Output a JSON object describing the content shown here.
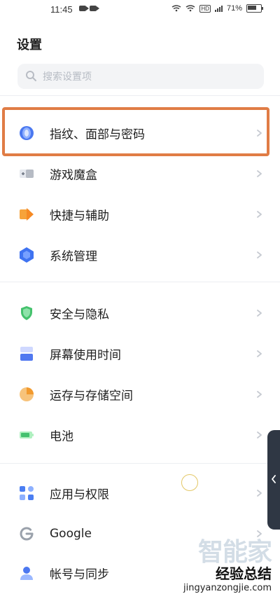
{
  "status_bar": {
    "time": "11:45",
    "battery_text": "71%"
  },
  "header": {
    "title": "设置"
  },
  "search": {
    "placeholder": "搜索设置项"
  },
  "items": [
    {
      "label": "指纹、面部与密码",
      "icon": "fingerprint-icon"
    },
    {
      "label": "游戏魔盒",
      "icon": "game-box-icon"
    },
    {
      "label": "快捷与辅助",
      "icon": "shortcut-assist-icon"
    },
    {
      "label": "系统管理",
      "icon": "system-management-icon"
    },
    {
      "label": "安全与隐私",
      "icon": "security-shield-icon"
    },
    {
      "label": "屏幕使用时间",
      "icon": "screen-time-icon"
    },
    {
      "label": "运存与存储空间",
      "icon": "storage-pie-icon"
    },
    {
      "label": "电池",
      "icon": "battery-icon"
    },
    {
      "label": "应用与权限",
      "icon": "apps-grid-icon"
    },
    {
      "label": "Google",
      "icon": "google-icon"
    },
    {
      "label": "帐号与同步",
      "icon": "account-sync-icon"
    }
  ],
  "watermark": {
    "logo": "智能家",
    "sub": "经验总结",
    "url": "jingyanzongjie.com"
  },
  "colors": {
    "highlight": "#e07c45",
    "accent_blue": "#4a78f0",
    "accent_green": "#45c26d",
    "accent_orange": "#f6a33a"
  }
}
